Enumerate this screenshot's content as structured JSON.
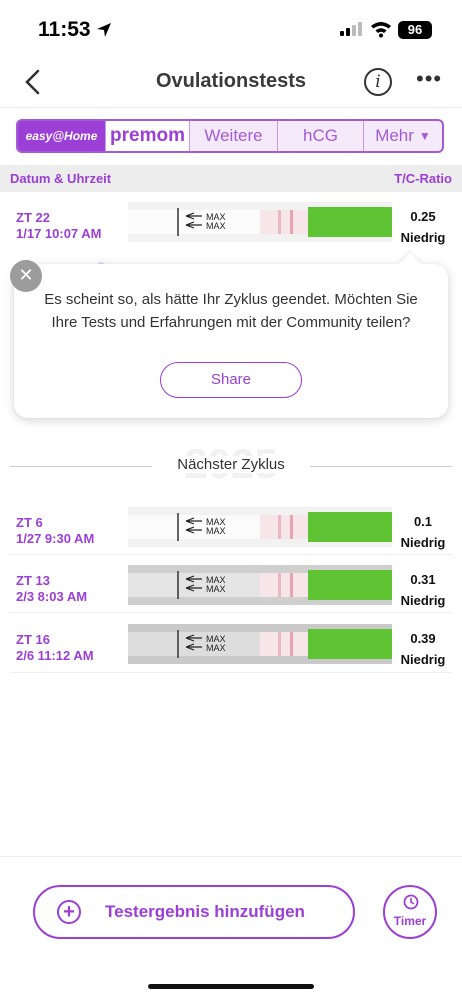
{
  "status": {
    "time": "11:53",
    "battery": "96"
  },
  "header": {
    "title": "Ovulationstests",
    "info_glyph": "i",
    "more_glyph": "•••",
    "back_icon": "chevron-left-icon"
  },
  "tabs": [
    {
      "label": "easy@Home",
      "selected": true
    },
    {
      "label": "premom",
      "selected": false
    },
    {
      "label": "Weitere",
      "selected": false
    },
    {
      "label": "hCG",
      "selected": false
    },
    {
      "label": "Mehr",
      "selected": false
    }
  ],
  "table": {
    "col_left": "Datum & Uhrzeit",
    "col_right": "T/C-Ratio"
  },
  "first_row": {
    "cycle_day": "ZT 22",
    "datetime": "1/17 10:07 AM",
    "ratio": "0.25",
    "level": "Niedrig"
  },
  "popup": {
    "message": "Es scheint so, als hätte Ihr Zyklus geendet. Möchten Sie Ihre Tests und Erfahrungen mit der Community teilen?",
    "share_label": "Share"
  },
  "cycle": {
    "watermark": "2025",
    "label": "Nächster Zyklus"
  },
  "rows": [
    {
      "cycle_day": "ZT 6",
      "datetime": "1/27 9:30 AM",
      "ratio": "0.1",
      "level": "Niedrig"
    },
    {
      "cycle_day": "ZT 13",
      "datetime": "2/3 8:03 AM",
      "ratio": "0.31",
      "level": "Niedrig"
    },
    {
      "cycle_day": "ZT 16",
      "datetime": "2/6 11:12 AM",
      "ratio": "0.39",
      "level": "Niedrig"
    }
  ],
  "strip_text": "MAX",
  "actions": {
    "add_label": "Testergebnis hinzufügen",
    "timer_label": "Timer"
  },
  "colors": {
    "accent": "#9b3fd7",
    "strip_handle": "#5fc434",
    "line": "#e8a3b4"
  }
}
